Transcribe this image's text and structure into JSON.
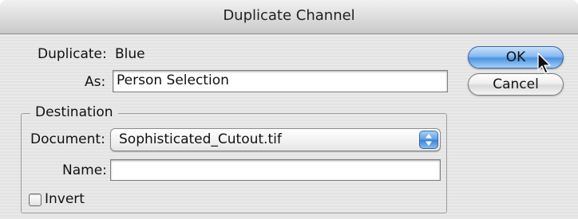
{
  "window": {
    "title": "Duplicate Channel"
  },
  "form": {
    "duplicate_label": "Duplicate:",
    "duplicate_value": "Blue",
    "as_label": "As:",
    "as_value": "Person Selection",
    "destination_title": "Destination",
    "document_label": "Document:",
    "document_value": "Sophisticated_Cutout.tif",
    "name_label": "Name:",
    "name_value": "",
    "invert_label": "Invert",
    "invert_checked": false
  },
  "buttons": {
    "ok_label": "OK",
    "cancel_label": "Cancel"
  },
  "icons": {
    "popup_arrows": "up-down-arrows-icon",
    "cursor": "mouse-pointer-icon"
  },
  "colors": {
    "default_button": "#5a9ce6",
    "popup_accent": "#4d8fdc"
  }
}
